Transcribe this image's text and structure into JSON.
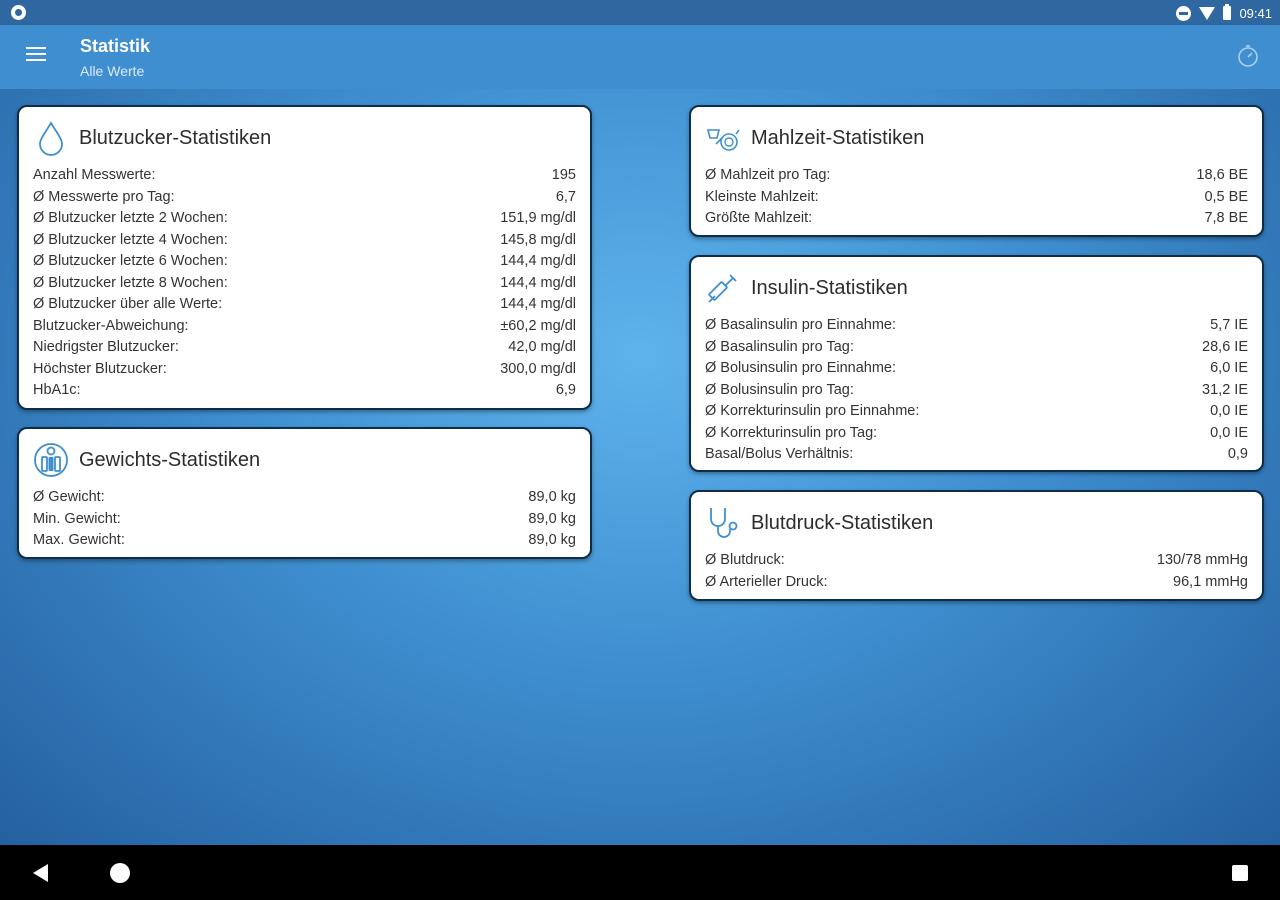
{
  "status_bar": {
    "time": "09:41"
  },
  "app_bar": {
    "title": "Statistik",
    "subtitle": "Alle Werte"
  },
  "cards": {
    "blutzucker": {
      "title": "Blutzucker-Statistiken",
      "icon": "drop-icon",
      "rows": [
        {
          "label": "Anzahl Messwerte:",
          "value": "195"
        },
        {
          "label": "Ø Messwerte pro Tag:",
          "value": "6,7"
        },
        {
          "label": "Ø Blutzucker letzte 2 Wochen:",
          "value": "151,9 mg/dl"
        },
        {
          "label": "Ø Blutzucker letzte 4 Wochen:",
          "value": "145,8 mg/dl"
        },
        {
          "label": "Ø Blutzucker letzte 6 Wochen:",
          "value": "144,4 mg/dl"
        },
        {
          "label": "Ø Blutzucker letzte 8 Wochen:",
          "value": "144,4 mg/dl"
        },
        {
          "label": "Ø Blutzucker über alle Werte:",
          "value": "144,4 mg/dl"
        },
        {
          "label": "Blutzucker-Abweichung:",
          "value": "±60,2 mg/dl"
        },
        {
          "label": "Niedrigster Blutzucker:",
          "value": "42,0 mg/dl"
        },
        {
          "label": "Höchster Blutzucker:",
          "value": "300,0 mg/dl"
        },
        {
          "label": "HbA1c:",
          "value": "6,9"
        }
      ]
    },
    "gewicht": {
      "title": "Gewichts-Statistiken",
      "icon": "scale-icon",
      "rows": [
        {
          "label": "Ø Gewicht:",
          "value": "89,0 kg"
        },
        {
          "label": "Min. Gewicht:",
          "value": "89,0 kg"
        },
        {
          "label": "Max. Gewicht:",
          "value": "89,0 kg"
        }
      ]
    },
    "mahlzeit": {
      "title": "Mahlzeit-Statistiken",
      "icon": "meal-icon",
      "rows": [
        {
          "label": "Ø Mahlzeit pro Tag:",
          "value": "18,6 BE"
        },
        {
          "label": "Kleinste Mahlzeit:",
          "value": "0,5 BE"
        },
        {
          "label": "Größte Mahlzeit:",
          "value": "7,8 BE"
        }
      ]
    },
    "insulin": {
      "title": "Insulin-Statistiken",
      "icon": "syringe-icon",
      "rows": [
        {
          "label": "Ø Basalinsulin pro Einnahme:",
          "value": "5,7 IE"
        },
        {
          "label": "Ø Basalinsulin pro Tag:",
          "value": "28,6 IE"
        },
        {
          "label": "Ø Bolusinsulin pro Einnahme:",
          "value": "6,0 IE"
        },
        {
          "label": "Ø Bolusinsulin pro Tag:",
          "value": "31,2 IE"
        },
        {
          "label": "Ø Korrekturinsulin pro Einnahme:",
          "value": "0,0 IE"
        },
        {
          "label": "Ø Korrekturinsulin pro Tag:",
          "value": "0,0 IE"
        },
        {
          "label": "Basal/Bolus Verhältnis:",
          "value": "0,9"
        }
      ]
    },
    "blutdruck": {
      "title": "Blutdruck-Statistiken",
      "icon": "stethoscope-icon",
      "rows": [
        {
          "label": "Ø Blutdruck:",
          "value": "130/78 mmHg"
        },
        {
          "label": "Ø Arterieller Druck:",
          "value": "96,1 mmHg"
        }
      ]
    }
  }
}
